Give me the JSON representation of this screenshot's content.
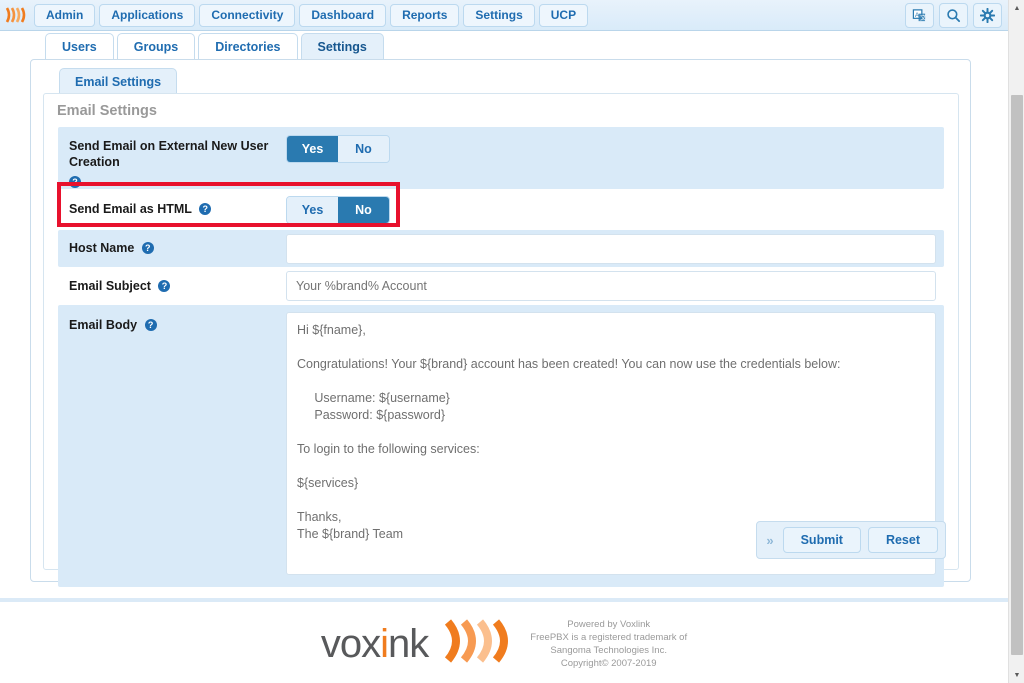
{
  "navbar": {
    "logo_icon": "voxlink-waves-logo",
    "items": [
      {
        "label": "Admin"
      },
      {
        "label": "Applications"
      },
      {
        "label": "Connectivity"
      },
      {
        "label": "Dashboard"
      },
      {
        "label": "Reports"
      },
      {
        "label": "Settings"
      },
      {
        "label": "UCP"
      }
    ],
    "right_icons": [
      {
        "name": "language-icon"
      },
      {
        "name": "search-icon"
      },
      {
        "name": "gear-icon"
      }
    ]
  },
  "subtabs": [
    {
      "label": "Users",
      "active": false
    },
    {
      "label": "Groups",
      "active": false
    },
    {
      "label": "Directories",
      "active": false
    },
    {
      "label": "Settings",
      "active": true
    }
  ],
  "inner_tab": {
    "label": "Email Settings"
  },
  "card": {
    "title": "Email Settings"
  },
  "form": {
    "rows": [
      {
        "label": "Send Email on External New User Creation",
        "control": "toggle",
        "options": [
          "Yes",
          "No"
        ],
        "selected": "Yes",
        "help_below": true
      },
      {
        "label": "Send Email as HTML",
        "control": "toggle",
        "options": [
          "Yes",
          "No"
        ],
        "selected": "No",
        "help_below": false
      },
      {
        "label": "Host Name",
        "control": "input",
        "value": "",
        "placeholder": ""
      },
      {
        "label": "Email Subject",
        "control": "input",
        "value": "",
        "placeholder": "Your %brand% Account"
      },
      {
        "label": "Email Body",
        "control": "textarea",
        "value": "Hi ${fname},\n\nCongratulations! Your ${brand} account has been created! You can now use the credentials below:\n\n     Username: ${username}\n     Password: ${password}\n\nTo login to the following services:\n\n${services}\n\nThanks,\nThe ${brand} Team"
      }
    ]
  },
  "actions": {
    "chevron": "»",
    "submit_label": "Submit",
    "reset_label": "Reset"
  },
  "footer": {
    "brand_prefix": "vox",
    "brand_i": "i",
    "brand_suffix": "nk",
    "logo_icon": "voxlink-waves-logo",
    "lines": [
      "Powered by Voxlink",
      "FreePBX is a registered trademark of",
      "Sangoma Technologies Inc.",
      "Copyright© 2007-2019"
    ]
  },
  "colors": {
    "accent_blue": "#2a7ab0",
    "link_blue": "#1f6cb0",
    "row_shaded": "#d9eaf8",
    "annotation_red": "#e8112d",
    "brand_orange": "#f07c1e"
  },
  "scrollbar": {
    "up_arrow": "▲",
    "down_arrow": "▼"
  }
}
